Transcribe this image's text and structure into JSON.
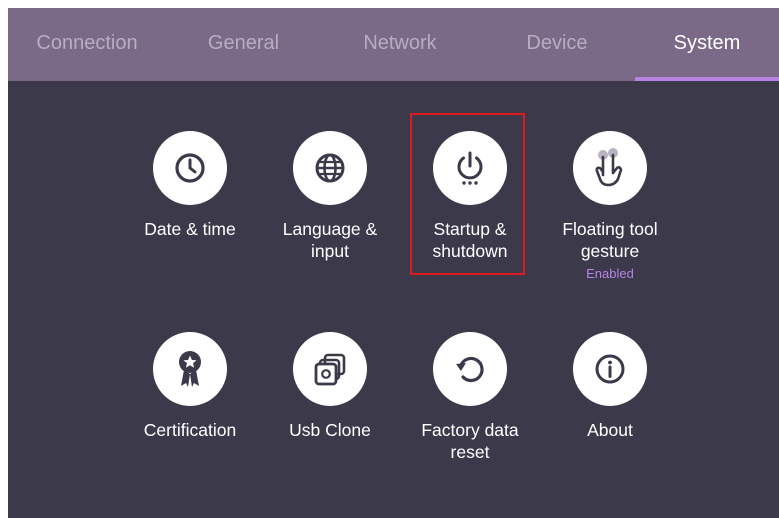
{
  "tabs": [
    {
      "label": "Connection",
      "active": false
    },
    {
      "label": "General",
      "active": false
    },
    {
      "label": "Network",
      "active": false
    },
    {
      "label": "Device",
      "active": false
    },
    {
      "label": "System",
      "active": true
    }
  ],
  "colors": {
    "background": "#3c3a4a",
    "tab_bar": "#7a6a88",
    "accent": "#b384e6",
    "highlight_border": "#e0191f"
  },
  "items": [
    {
      "label": "Date & time",
      "icon": "clock-icon"
    },
    {
      "label": "Language &\ninput",
      "icon": "globe-icon"
    },
    {
      "label": "Startup &\nshutdown",
      "icon": "power-icon",
      "highlighted": true
    },
    {
      "label": "Floating tool\ngesture",
      "icon": "two-finger-touch-icon",
      "status": "Enabled"
    },
    {
      "label": "Certification",
      "icon": "award-ribbon-icon"
    },
    {
      "label": "Usb Clone",
      "icon": "copy-icon"
    },
    {
      "label": "Factory data\nreset",
      "icon": "reset-icon"
    },
    {
      "label": "About",
      "icon": "info-icon"
    }
  ]
}
